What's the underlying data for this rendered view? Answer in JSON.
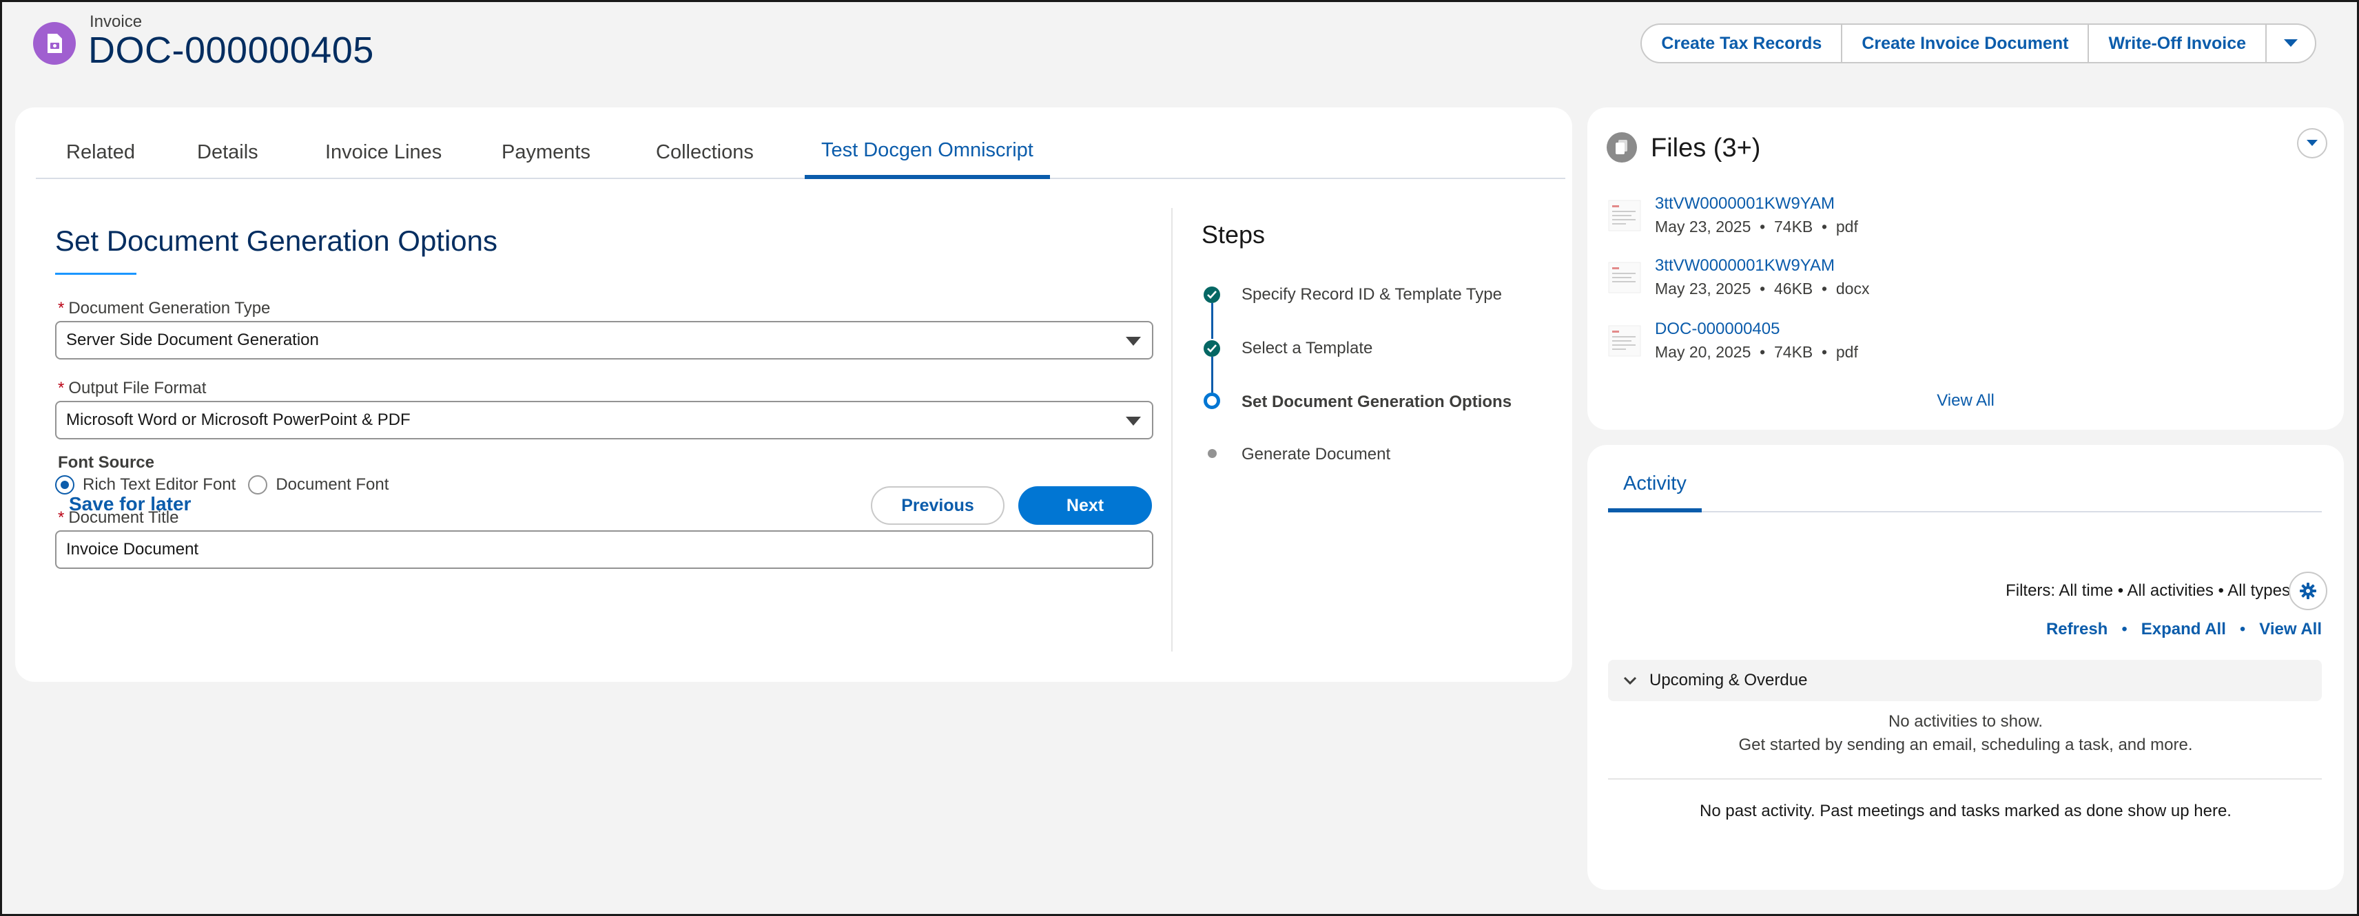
{
  "header": {
    "object_label": "Invoice",
    "record_title": "DOC-000000405",
    "actions": [
      "Create Tax Records",
      "Create Invoice Document",
      "Write-Off Invoice"
    ]
  },
  "tabs": [
    {
      "label": "Related",
      "active": false
    },
    {
      "label": "Details",
      "active": false
    },
    {
      "label": "Invoice Lines",
      "active": false
    },
    {
      "label": "Payments",
      "active": false
    },
    {
      "label": "Collections",
      "active": false
    },
    {
      "label": "Test Docgen Omniscript",
      "active": true
    }
  ],
  "form": {
    "title": "Set Document Generation Options",
    "doc_gen_type": {
      "label": "Document Generation Type",
      "value": "Server Side Document Generation"
    },
    "output_format": {
      "label": "Output File Format",
      "value": "Microsoft Word or Microsoft PowerPoint & PDF"
    },
    "font_source": {
      "label": "Font Source",
      "options": [
        {
          "label": "Rich Text Editor Font",
          "checked": true
        },
        {
          "label": "Document Font",
          "checked": false
        }
      ]
    },
    "doc_title": {
      "label": "Document Title",
      "value": "Invoice Document"
    },
    "required_marker": "*",
    "save_later": "Save for later",
    "previous": "Previous",
    "next": "Next"
  },
  "steps": {
    "title": "Steps",
    "items": [
      {
        "label": "Specify Record ID & Template Type",
        "status": "done"
      },
      {
        "label": "Select a Template",
        "status": "done"
      },
      {
        "label": "Set Document Generation Options",
        "status": "current"
      },
      {
        "label": "Generate Document",
        "status": "todo"
      }
    ]
  },
  "files": {
    "title": "Files (3+)",
    "items": [
      {
        "name": "3ttVW0000001KW9YAM",
        "date": "May 23, 2025",
        "size": "74KB",
        "type": "pdf"
      },
      {
        "name": "3ttVW0000001KW9YAM",
        "date": "May 23, 2025",
        "size": "46KB",
        "type": "docx"
      },
      {
        "name": "DOC-000000405",
        "date": "May 20, 2025",
        "size": "74KB",
        "type": "pdf"
      }
    ],
    "view_all": "View All"
  },
  "activity": {
    "tab": "Activity",
    "filters": "Filters: All time • All activities • All types",
    "links": [
      "Refresh",
      "Expand All",
      "View All"
    ],
    "upcoming": "Upcoming & Overdue",
    "no_activities": "No activities to show.",
    "get_started": "Get started by sending an email, scheduling a task, and more.",
    "past": "No past activity. Past meetings and tasks marked as done show up here."
  },
  "colors": {
    "brand_blue": "#0b5cab",
    "button_blue": "#0176d3",
    "object_icon": "#a05fd0",
    "step_done": "#056764",
    "required": "#ba0517"
  },
  "icons": {
    "object": "document-invoice-icon",
    "files": "files-icon",
    "gear": "gear-icon",
    "chevron": "chevron-down-icon"
  }
}
